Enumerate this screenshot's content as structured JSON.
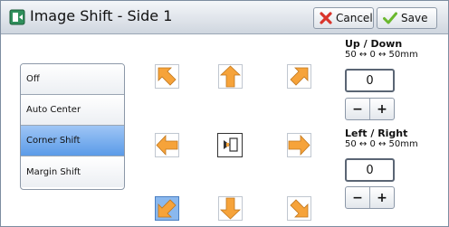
{
  "header": {
    "title": "Image Shift - Side 1",
    "cancel_label": "Cancel",
    "save_label": "Save"
  },
  "shift_options": [
    {
      "label": "Off",
      "selected": false
    },
    {
      "label": "Auto Center",
      "selected": false
    },
    {
      "label": "Corner Shift",
      "selected": true
    },
    {
      "label": "Margin Shift",
      "selected": false
    }
  ],
  "arrows": {
    "up_left": "arrow-up-left-icon",
    "up": "arrow-up-icon",
    "up_right": "arrow-up-right-icon",
    "left": "arrow-left-icon",
    "right": "arrow-right-icon",
    "down_left": "arrow-down-left-icon",
    "down": "arrow-down-icon",
    "down_right": "arrow-down-right-icon",
    "selected": "down_left"
  },
  "up_down": {
    "title": "Up / Down",
    "range": "50 ↔ 0 ↔ 50mm",
    "value": "0",
    "minus": "−",
    "plus": "+"
  },
  "left_right": {
    "title": "Left / Right",
    "range": "50 ↔ 0 ↔ 50mm",
    "value": "0",
    "minus": "−",
    "plus": "+"
  },
  "colors": {
    "arrow_orange": "#f6a33a",
    "selected_blue": "#5b9be8",
    "cancel_red": "#d9342b",
    "save_green": "#6ab82e"
  }
}
